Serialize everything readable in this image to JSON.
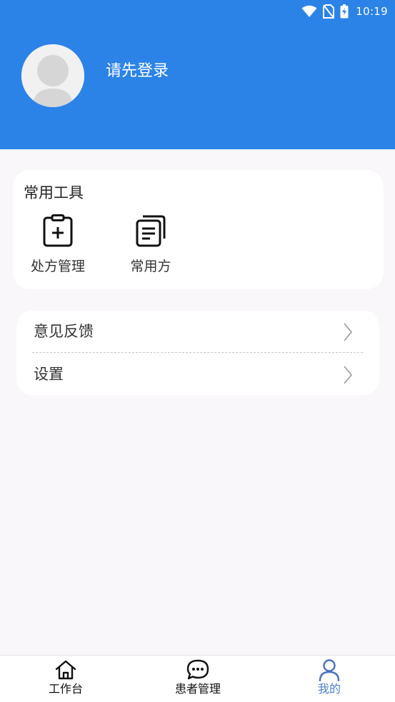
{
  "status_bar": {
    "time": "10:19",
    "icons": [
      "wifi-icon",
      "no-sim-icon",
      "battery-charging-icon"
    ]
  },
  "profile": {
    "login_prompt": "请先登录",
    "avatar_icon": "default-avatar-icon"
  },
  "tools": {
    "title": "常用工具",
    "items": [
      {
        "label": "处方管理",
        "icon": "prescription-clipboard-icon"
      },
      {
        "label": "常用方",
        "icon": "documents-stack-icon"
      }
    ]
  },
  "menu": {
    "items": [
      {
        "label": "意见反馈",
        "icon": "chevron-right-icon"
      },
      {
        "label": "设置",
        "icon": "chevron-right-icon"
      }
    ]
  },
  "bottom_nav": {
    "items": [
      {
        "label": "工作台",
        "icon": "home-icon",
        "active": false
      },
      {
        "label": "患者管理",
        "icon": "chat-bubble-icon",
        "active": false
      },
      {
        "label": "我的",
        "icon": "person-icon",
        "active": true
      }
    ]
  },
  "colors": {
    "header_bg": "#2b83e8",
    "page_bg": "#f9f7f9",
    "active_tab": "#4a80d0"
  }
}
